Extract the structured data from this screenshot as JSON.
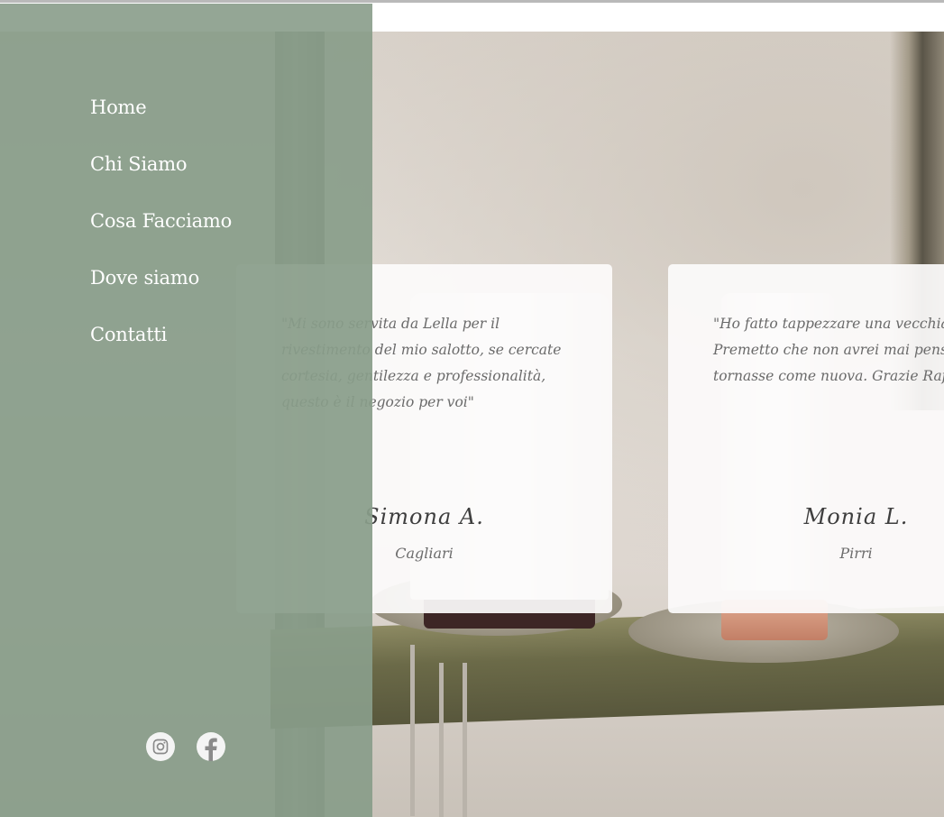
{
  "nav": {
    "items": [
      "Home",
      "Chi Siamo",
      "Cosa Facciamo",
      "Dove siamo",
      "Contatti"
    ]
  },
  "testimonials": [
    {
      "quote": "\"Mi sono servita da Lella per il rivestimento del mio salotto, se cercate cortesia, gentilezza e professionalità, questo è il negozio per voi\"",
      "name": "Simona A.",
      "city": "Cagliari"
    },
    {
      "quote_lines": [
        "\"Ho fatto tappezzare una vecchia po",
        "Premetto che non avrei mai pensato",
        "tornasse come nuova. Grazie Raffae"
      ],
      "name": "Monia L.",
      "city": "Pirri"
    }
  ],
  "social": {
    "icons": [
      "instagram-icon",
      "facebook-icon"
    ]
  },
  "colors": {
    "sidebar": "#899d8a",
    "nav_text": "#ffffff",
    "card": "#fcfbfb"
  }
}
